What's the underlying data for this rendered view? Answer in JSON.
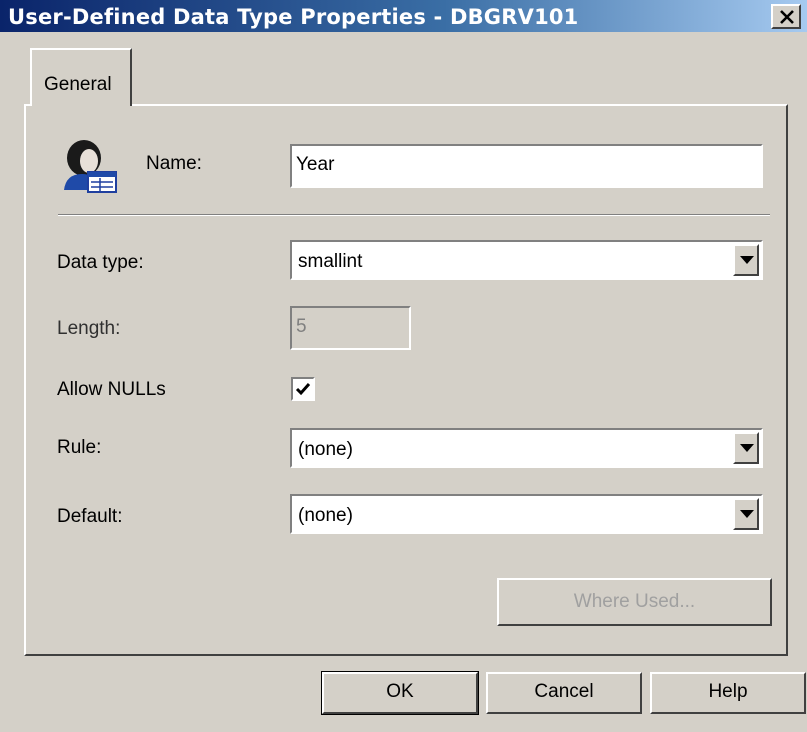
{
  "window": {
    "title": "User-Defined Data Type Properties - DBGRV101"
  },
  "tabs": [
    {
      "label": "General"
    }
  ],
  "form": {
    "name_label": "Name:",
    "name_value": "Year",
    "data_type_label": "Data type:",
    "data_type_value": "smallint",
    "length_label": "Length:",
    "length_value": "5",
    "allow_nulls_label": "Allow NULLs",
    "allow_nulls_checked": true,
    "rule_label": "Rule:",
    "rule_value": "(none)",
    "default_label": "Default:",
    "default_value": "(none)"
  },
  "buttons": {
    "where_used": "Where Used...",
    "ok": "OK",
    "cancel": "Cancel",
    "help": "Help"
  },
  "icons": {
    "close": "close-icon",
    "user_type": "user-datatype-icon",
    "dropdown": "chevron-down-icon",
    "check": "check-icon"
  },
  "colors": {
    "titlebar_start": "#0a246a",
    "titlebar_end": "#a6caf0",
    "face": "#d4d0c8"
  }
}
